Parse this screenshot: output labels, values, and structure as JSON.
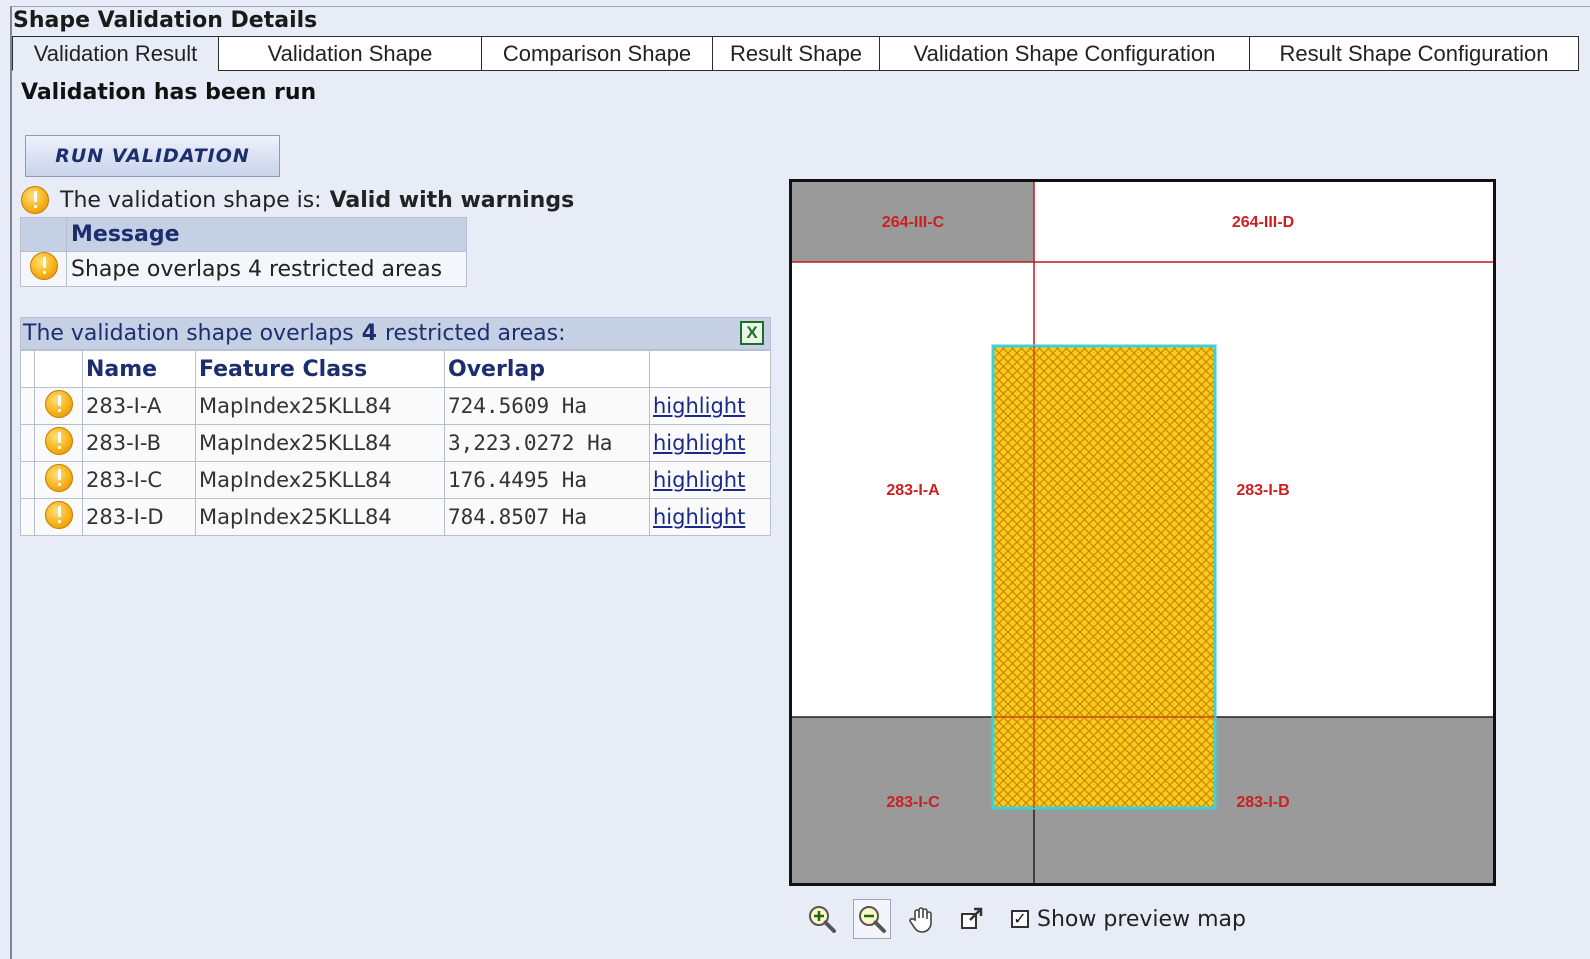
{
  "panel": {
    "title": "Shape Validation Details"
  },
  "tabs": [
    {
      "label": "Validation Result",
      "active": true
    },
    {
      "label": "Validation Shape",
      "active": false
    },
    {
      "label": "Comparison Shape",
      "active": false
    },
    {
      "label": "Result Shape",
      "active": false
    },
    {
      "label": "Validation Shape Configuration",
      "active": false
    },
    {
      "label": "Result Shape Configuration",
      "active": false
    }
  ],
  "status": {
    "heading": "Validation has been run",
    "run_button": "RUN VALIDATION",
    "validity_label": "The validation shape is:",
    "validity_value": "Valid with warnings"
  },
  "messages": {
    "header": "Message",
    "rows": [
      {
        "icon": "warning-icon",
        "text": "Shape overlaps 4 restricted areas"
      }
    ]
  },
  "overlaps": {
    "header_prefix": "The validation shape overlaps",
    "count": "4",
    "header_suffix": "restricted areas:",
    "export_icon": "excel-export-icon",
    "columns": [
      "Name",
      "Feature Class",
      "Overlap"
    ],
    "rows": [
      {
        "name": "283-I-A",
        "feature_class": "MapIndex25KLL84",
        "overlap": "724.5609 Ha",
        "action": "highlight"
      },
      {
        "name": "283-I-B",
        "feature_class": "MapIndex25KLL84",
        "overlap": "3,223.0272 Ha",
        "action": "highlight"
      },
      {
        "name": "283-I-C",
        "feature_class": "MapIndex25KLL84",
        "overlap": "176.4495 Ha",
        "action": "highlight"
      },
      {
        "name": "283-I-D",
        "feature_class": "MapIndex25KLL84",
        "overlap": "784.8507 Ha",
        "action": "highlight"
      }
    ]
  },
  "map": {
    "labels": {
      "tl": "264-III-C",
      "tr": "264-III-D",
      "ml": "283-I-A",
      "mr": "283-I-B",
      "bl": "283-I-C",
      "br": "283-I-D"
    },
    "colors": {
      "label": "#cc1f1f",
      "grid_line": "#c01818",
      "restricted_fill": "#9a9a9a",
      "shape_fill": "#f2cf19",
      "shape_hatch": "#d97f0a",
      "shape_border": "#3cd3d8"
    }
  },
  "map_toolbar": {
    "tools": [
      "zoom-in-icon",
      "zoom-out-icon",
      "pan-hand-icon",
      "popout-icon"
    ],
    "active_tool": "zoom-out-icon",
    "preview_checked": true,
    "preview_label": "Show preview map"
  }
}
